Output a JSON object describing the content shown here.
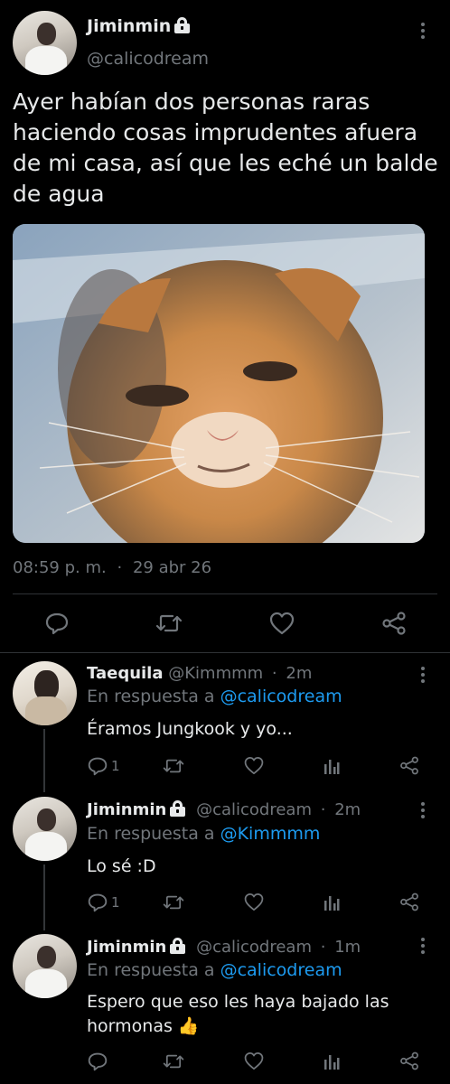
{
  "tweet": {
    "display_name": "Jiminmin",
    "handle": "@calicodream",
    "text": "Ayer habían dos personas raras haciendo cosas imprudentes afuera de mi casa, así que les eché un balde de agua",
    "time": "08:59 p. m.",
    "separator": "·",
    "date": "29 abr 26"
  },
  "replies": [
    {
      "display_name": "Taequila",
      "handle": "@Kimmmm",
      "separator": "·",
      "time": "2m",
      "reply_prefix": "En respuesta a",
      "reply_to": "@calicodream",
      "text": "Éramos Jungkook y yo...",
      "reply_count": "1"
    },
    {
      "display_name": "Jiminmin",
      "handle": "@calicodream",
      "separator": "·",
      "time": "2m",
      "reply_prefix": "En respuesta a",
      "reply_to": "@Kimmmm",
      "text": "Lo sé :D",
      "reply_count": "1"
    },
    {
      "display_name": "Jiminmin",
      "handle": "@calicodream",
      "separator": "·",
      "time": "1m",
      "reply_prefix": "En respuesta a",
      "reply_to": "@calicodream",
      "text_line1": "Espero que eso les haya bajado las",
      "text_line2": "hormonas",
      "emoji": "👍"
    }
  ],
  "colors": {
    "background": "#000000",
    "text": "#e7e9ea",
    "secondary": "#71767b",
    "link": "#1d9bf0",
    "divider": "#2f3336"
  },
  "icons": [
    "lock-icon",
    "more-icon",
    "reply-icon",
    "retweet-icon",
    "like-icon",
    "share-icon",
    "analytics-icon",
    "thumbs-up-emoji"
  ]
}
